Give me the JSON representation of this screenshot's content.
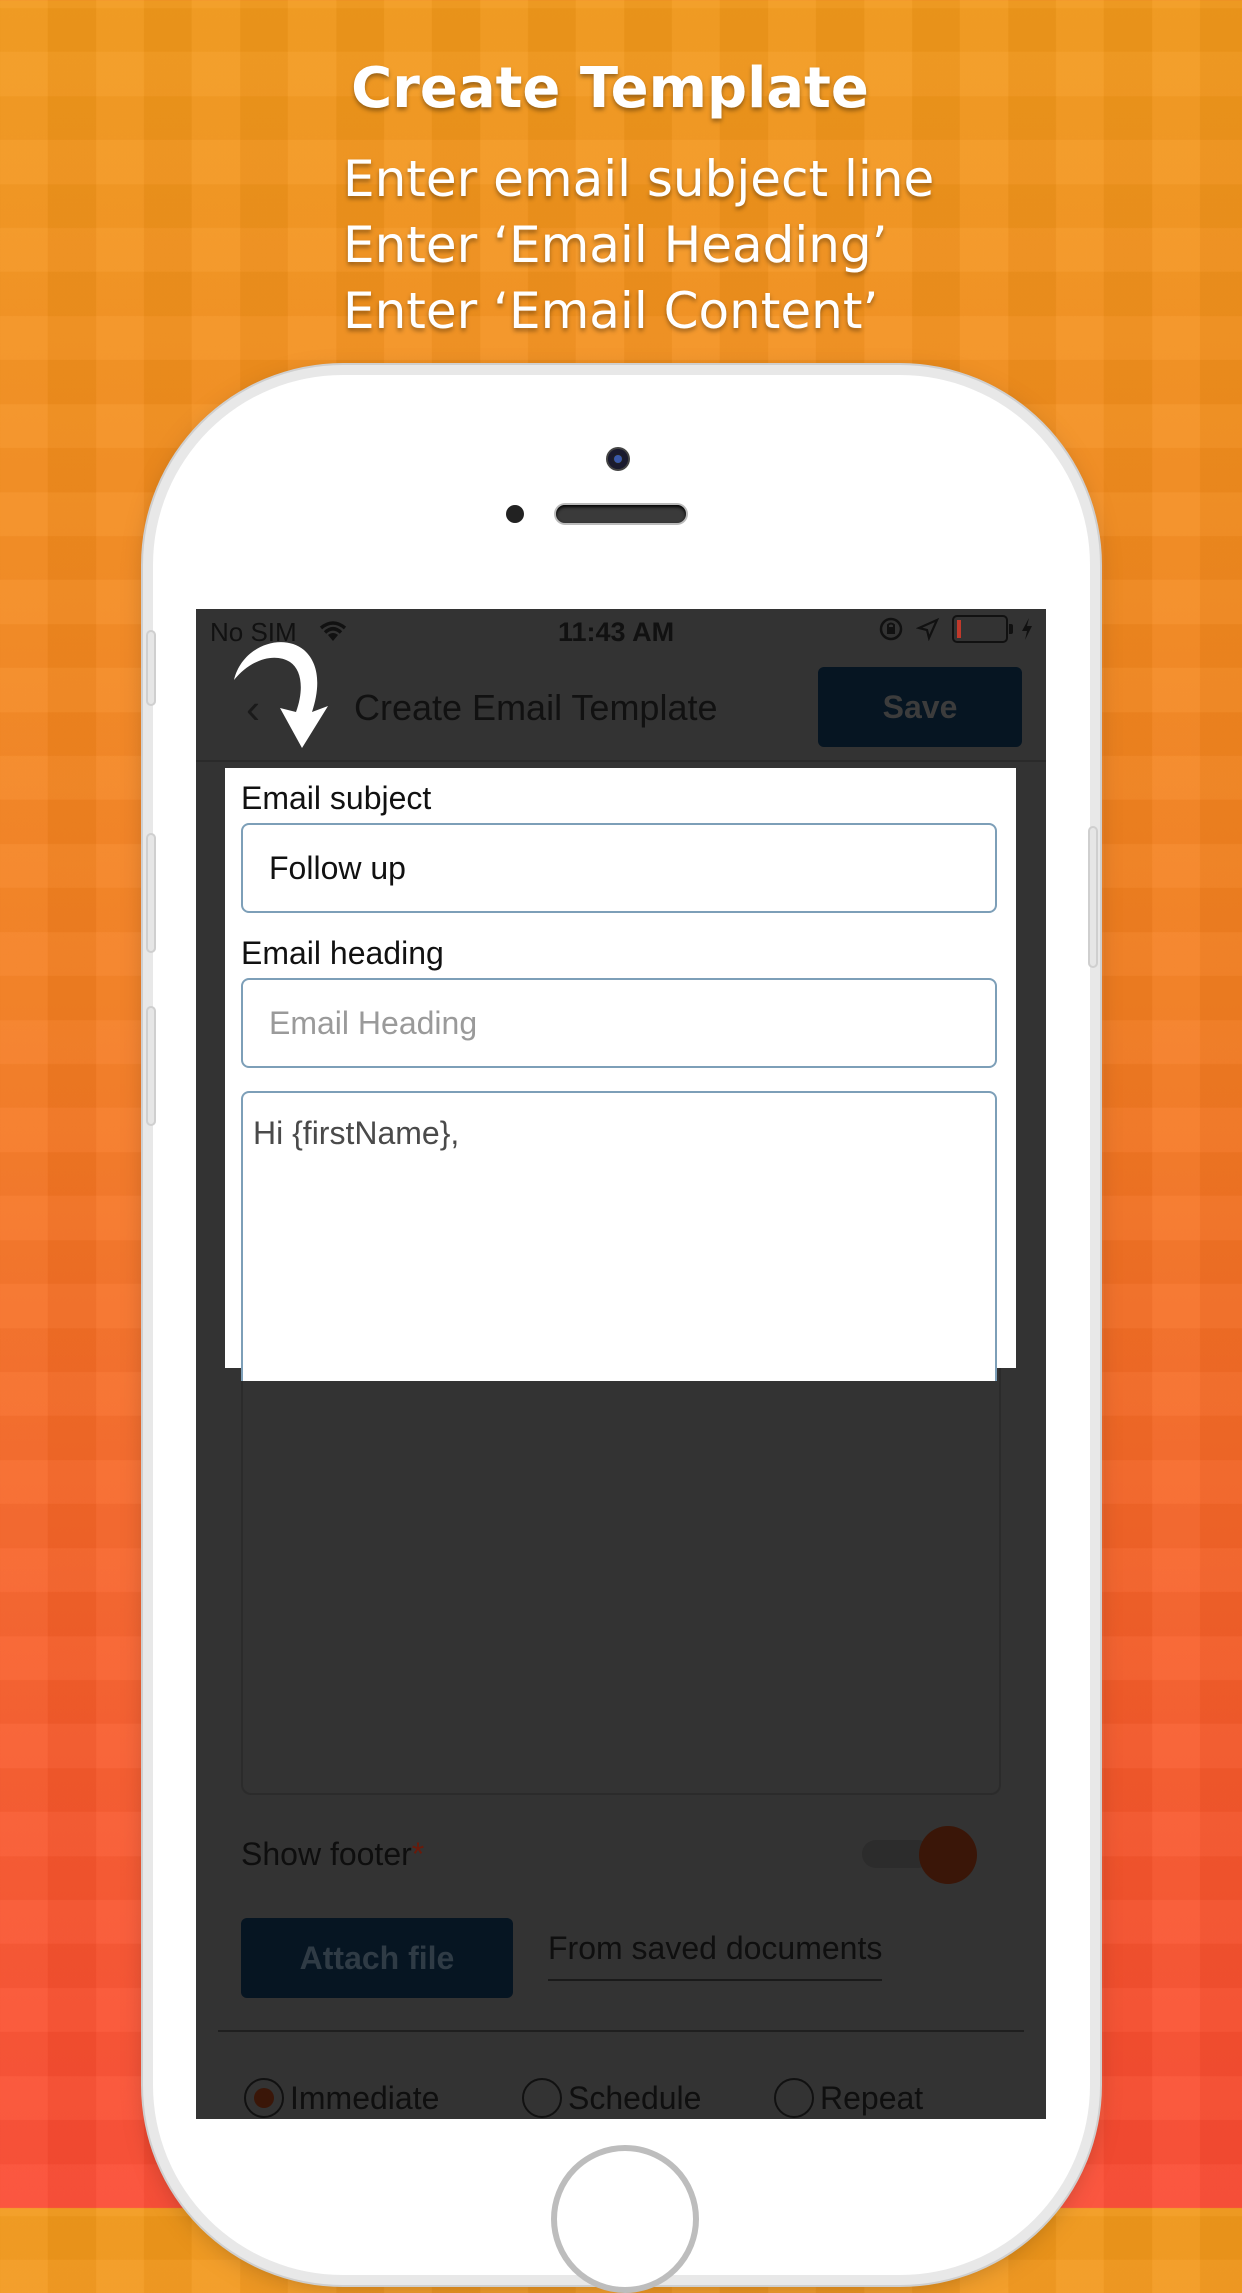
{
  "promo": {
    "title": "Create Template",
    "lines": [
      "Enter email subject line",
      "Enter ‘Email Heading’",
      "Enter ‘Email Content’"
    ]
  },
  "status_bar": {
    "carrier": "No SIM",
    "time": "11:43 AM"
  },
  "navbar": {
    "title": "Create Email Template",
    "save_label": "Save"
  },
  "form": {
    "subject_label": "Email subject",
    "subject_value": "Follow up",
    "heading_label": "Email heading",
    "heading_placeholder": "Email Heading",
    "content_value": "Hi {firstName},",
    "show_footer_label": "Show footer",
    "required_mark": "*",
    "attach_label": "Attach file",
    "saved_docs_label": "From saved documents"
  },
  "delivery_options": [
    {
      "label": "Immediate",
      "selected": true
    },
    {
      "label": "Schedule",
      "selected": false
    },
    {
      "label": "Repeat",
      "selected": false
    }
  ],
  "colors": {
    "accent_dark": "#061522",
    "toggle_on": "#3a1608",
    "field_border": "#7d9fb8"
  }
}
